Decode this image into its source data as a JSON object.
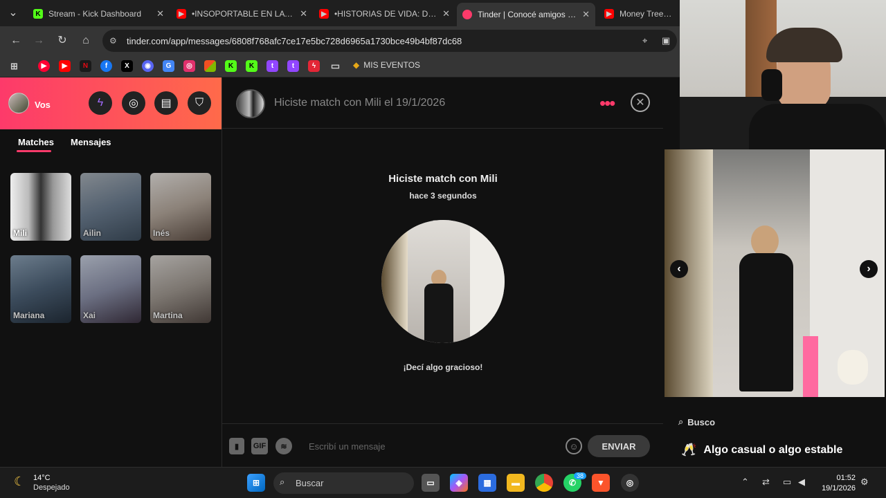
{
  "browser": {
    "tabs": [
      {
        "title": "Stream - Kick Dashboard",
        "icon": "kick-icon",
        "color": "#53fc18"
      },
      {
        "title": "•INSOPORTABLE EN LA HEL",
        "icon": "youtube-icon",
        "color": "#ff0000"
      },
      {
        "title": "•HISTORIAS DE VIDA: DANIE",
        "icon": "youtube-icon",
        "color": "#ff0000"
      },
      {
        "title": "Tinder | Conocé amigos y g",
        "icon": "tinder-icon",
        "color": "#fd3a6a"
      },
      {
        "title": "Money Trees - Yo",
        "icon": "youtube-icon",
        "color": "#ff0000"
      }
    ],
    "url": "tinder.com/app/messages/6808f768afc7ce17e5bc728d6965a1730bce49b4bf87dc68",
    "bookmark_folder": "MIS EVENTOS"
  },
  "sidebar": {
    "me_label": "Vos",
    "tabs": {
      "matches": "Matches",
      "messages": "Mensajes"
    },
    "matches": [
      {
        "name": "Mili"
      },
      {
        "name": "Ailin"
      },
      {
        "name": "Inés"
      },
      {
        "name": "Mariana"
      },
      {
        "name": "Xai"
      },
      {
        "name": "Martina"
      }
    ]
  },
  "chat": {
    "header_title": "Hiciste match con Mili el 19/1/2026",
    "match_prefix": "Hiciste match con ",
    "match_name": "Mili",
    "match_time": "hace 3 segundos",
    "hint": "¡Decí algo gracioso!",
    "input_placeholder": "Escribí un mensaje",
    "gif_label": "GIF",
    "send_label": "ENVIAR"
  },
  "profile": {
    "looking_for_label": "Busco",
    "looking_for_value": "Algo casual o algo estable"
  },
  "taskbar": {
    "weather_temp": "14°C",
    "weather_condition": "Despejado",
    "search_placeholder": "Buscar",
    "whatsapp_badge": "38",
    "time": "01:52",
    "date": "19/1/2026"
  },
  "colors": {
    "tinder_gradient_start": "#fd3a6a",
    "tinder_gradient_end": "#ff6a4a",
    "panel_bg": "#111111"
  }
}
